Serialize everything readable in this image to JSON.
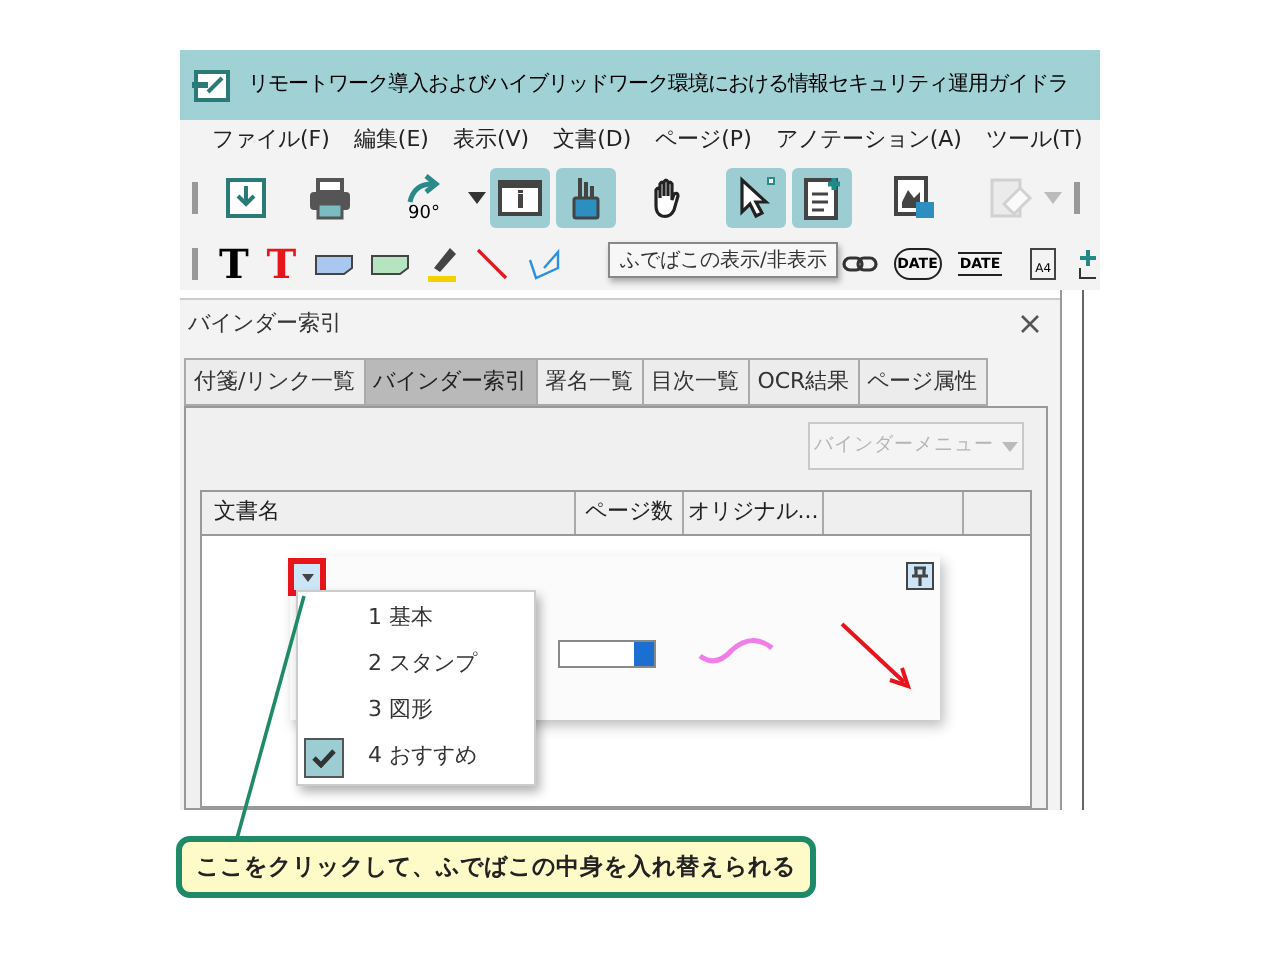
{
  "window": {
    "title": "リモートワーク導入およびハイブリッドワーク環境における情報セキュリティ運用ガイドラ"
  },
  "menu": [
    "ファイル(F)",
    "編集(E)",
    "表示(V)",
    "文書(D)",
    "ページ(P)",
    "アノテーション(A)",
    "ツール(T)"
  ],
  "toolbar": [
    {
      "kind": "save",
      "on": false,
      "disabled": false
    },
    {
      "kind": "print",
      "on": false,
      "disabled": false
    },
    {
      "kind": "rotate",
      "label": "90°",
      "dropdown": true,
      "on": false,
      "disabled": false
    },
    {
      "kind": "info",
      "on": true,
      "disabled": false
    },
    {
      "kind": "pencase",
      "on": true,
      "disabled": false
    },
    {
      "kind": "hand",
      "on": false,
      "disabled": false
    },
    {
      "kind": "pointer",
      "on": true,
      "disabled": false
    },
    {
      "kind": "note",
      "on": true,
      "disabled": false
    },
    {
      "kind": "image",
      "on": false,
      "disabled": false
    },
    {
      "kind": "eraser",
      "dropdown": true,
      "on": false,
      "disabled": true
    }
  ],
  "tooltip": "ふでばこの表示/非表示",
  "annotation_tools": [
    {
      "kind": "text",
      "label": "T",
      "color": "#000000"
    },
    {
      "kind": "text",
      "label": "T",
      "color": "#e8141c"
    },
    {
      "kind": "sticky",
      "color": "#a9c8ef"
    },
    {
      "kind": "sticky",
      "color": "#b5e5c0"
    },
    {
      "kind": "highlighter"
    },
    {
      "kind": "line"
    },
    {
      "kind": "polyline"
    },
    {
      "kind": "link"
    },
    {
      "kind": "date-stamp",
      "label": "DATE"
    },
    {
      "kind": "date",
      "label": "DATE"
    },
    {
      "kind": "page",
      "label": "A4"
    },
    {
      "kind": "add"
    }
  ],
  "panel": {
    "title": "バインダー索引",
    "tabs": [
      {
        "label": "付箋/リンク一覧",
        "selected": false
      },
      {
        "label": "バインダー索引",
        "selected": true
      },
      {
        "label": "署名一覧",
        "selected": false
      },
      {
        "label": "目次一覧",
        "selected": false
      },
      {
        "label": "OCR結果",
        "selected": false
      },
      {
        "label": "ページ属性",
        "selected": false
      }
    ],
    "menu_button": {
      "label": "バインダーメニュー",
      "disabled": true
    },
    "table": {
      "columns": [
        "文書名",
        "ページ数",
        "オリジナル..."
      ]
    }
  },
  "fudebako": {
    "sets": [
      {
        "label": "1 基本",
        "checked": false
      },
      {
        "label": "2 スタンプ",
        "checked": false
      },
      {
        "label": "3 図形",
        "checked": false
      },
      {
        "label": "4 おすすめ",
        "checked": true
      }
    ]
  },
  "callout": "ここをクリックして、ふでばこの中身を入れ替えられる"
}
